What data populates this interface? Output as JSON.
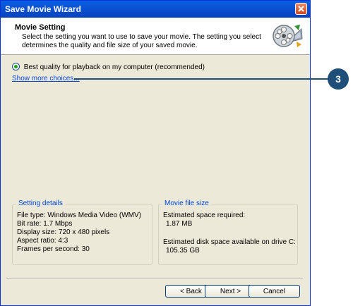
{
  "window": {
    "title": "Save Movie Wizard"
  },
  "header": {
    "title": "Movie Setting",
    "description": "Select the setting you want to use to save your movie. The setting you select determines the quality and file size of your saved movie."
  },
  "option": {
    "label": "Best quality for playback on my computer (recommended)",
    "selected": true
  },
  "show_more_link": "Show more choices...",
  "callout": {
    "number": "3"
  },
  "setting_details": {
    "title": "Setting details",
    "file_type": "File type: Windows Media Video (WMV)",
    "bit_rate": "Bit rate: 1.7 Mbps",
    "display_size": "Display size: 720 x 480 pixels",
    "aspect_ratio": "Aspect ratio: 4:3",
    "fps": "Frames per second: 30"
  },
  "movie_file_size": {
    "title": "Movie file size",
    "space_required_label": "Estimated space required:",
    "space_required_value": "1.87 MB",
    "disk_space_label": "Estimated disk space available on drive C:",
    "disk_space_value": "105.35 GB"
  },
  "buttons": {
    "back": "< Back",
    "next": "Next >",
    "cancel": "Cancel"
  }
}
